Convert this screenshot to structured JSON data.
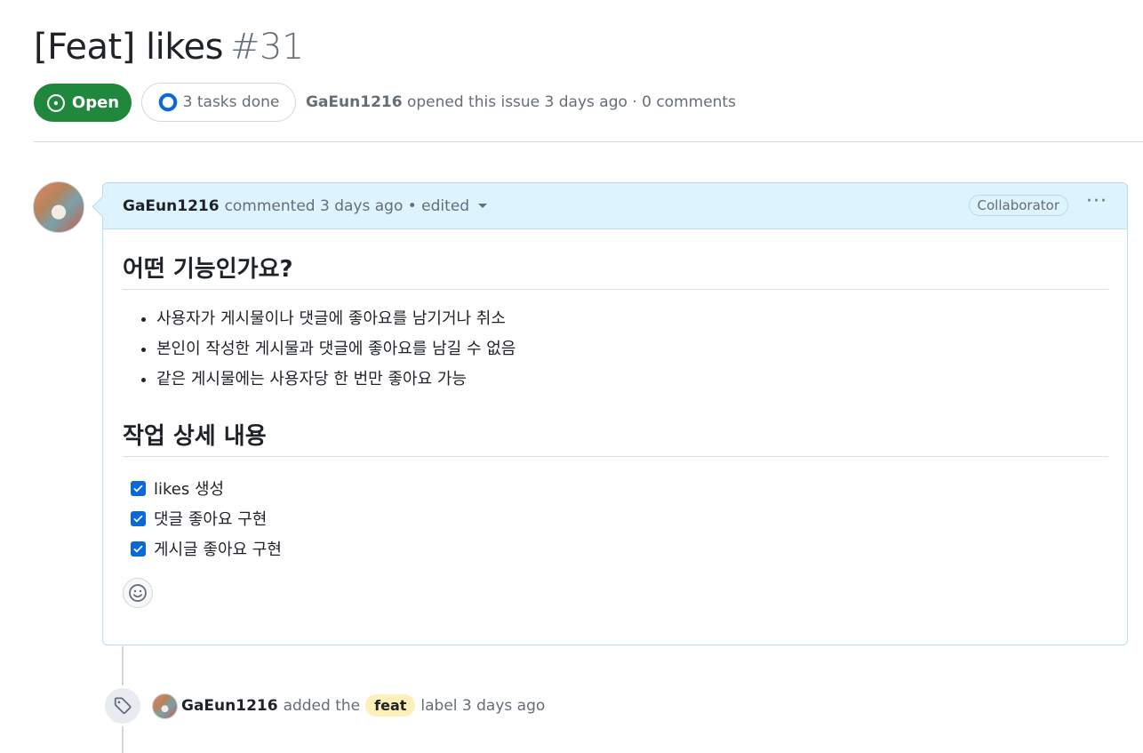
{
  "issue": {
    "title": "[Feat] likes",
    "number": "#31",
    "state": "Open",
    "tasks_label": "3 tasks done",
    "author": "GaEun1216",
    "opened_text": "opened this issue 3 days ago · 0 comments"
  },
  "comment": {
    "author": "GaEun1216",
    "meta": "commented 3 days ago • edited",
    "role_badge": "Collaborator",
    "more_label": "···",
    "section1_title": "어떤 기능인가요?",
    "bullets": [
      "사용자가 게시물이나 댓글에 좋아요를 남기거나 취소",
      "본인이 작성한 게시물과 댓글에 좋아요를 남길 수 없음",
      "같은 게시물에는 사용자당 한 번만 좋아요 가능"
    ],
    "section2_title": "작업 상세 내용",
    "tasks": [
      {
        "label": "likes 생성",
        "checked": true
      },
      {
        "label": "댓글 좋아요 구현",
        "checked": true
      },
      {
        "label": "게시글 좋아요 구현",
        "checked": true
      }
    ]
  },
  "timeline_event": {
    "actor": "GaEun1216",
    "text_before": "added the",
    "label_name": "feat",
    "label_color": "#fdf0b9",
    "text_after": "label 3 days ago"
  },
  "colors": {
    "open_green": "#1f883d",
    "accent_blue": "#0969da",
    "comment_header_bg": "#ddf4ff"
  }
}
